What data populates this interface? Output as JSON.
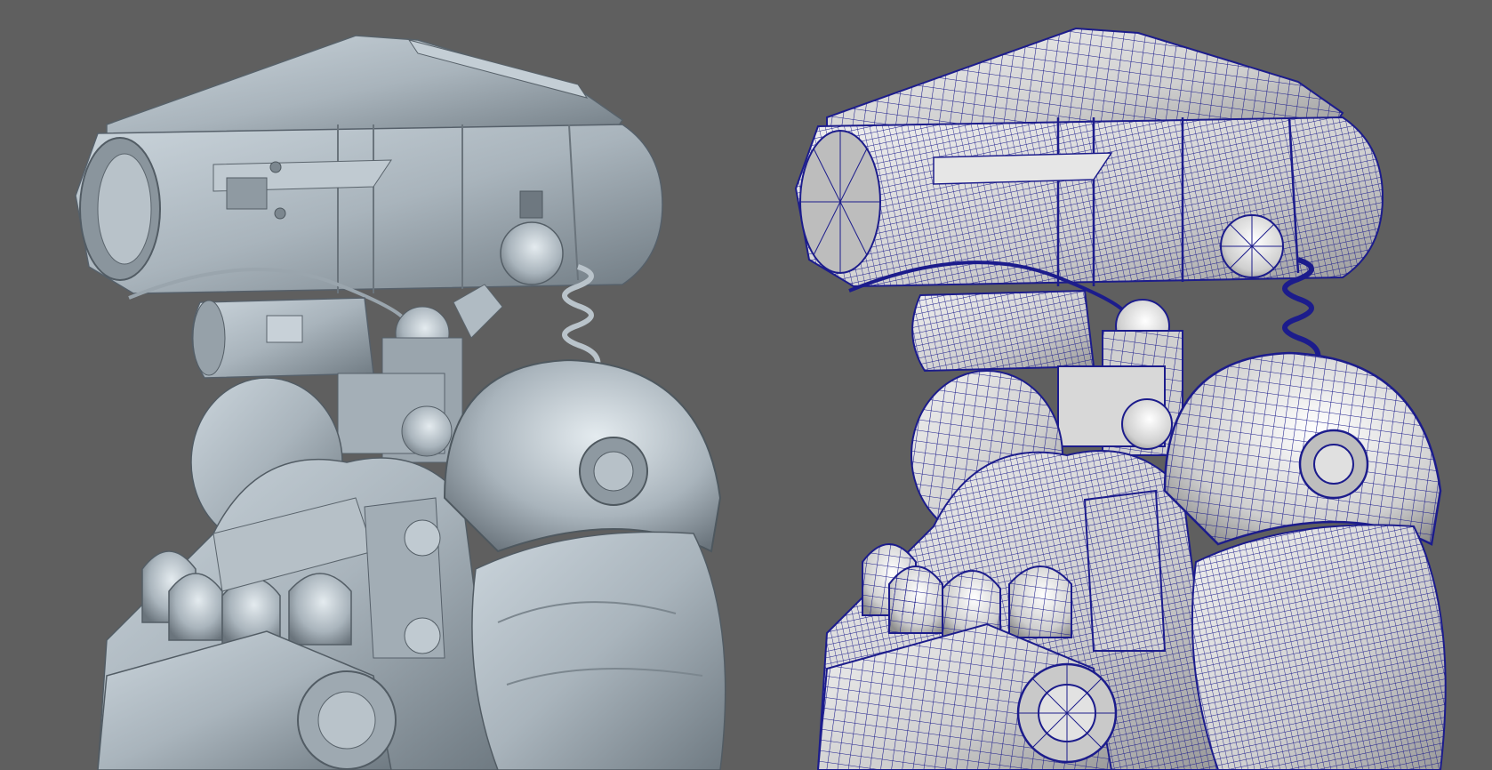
{
  "scene": {
    "background_color": "#5f5f5f",
    "shaded_color": "#a9b4bc",
    "shaded_dark": "#6f7a82",
    "shaded_light": "#d2dbe1",
    "wire_base": "#d9d9d9",
    "wire_color": "#1c1c8c",
    "left_view": "smooth-shaded-render",
    "right_view": "wireframe-on-shaded-render"
  }
}
